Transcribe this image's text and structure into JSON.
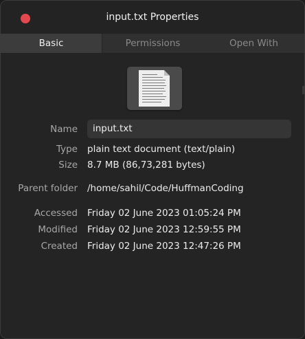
{
  "window": {
    "title": "input.txt Properties"
  },
  "tabs": [
    {
      "label": "Basic",
      "active": true
    },
    {
      "label": "Permissions",
      "active": false
    },
    {
      "label": "Open With",
      "active": false
    }
  ],
  "file": {
    "icon": "text-document-icon",
    "name_label": "Name",
    "name_value": "input.txt",
    "type_label": "Type",
    "type_value": "plain text document (text/plain)",
    "size_label": "Size",
    "size_value": "8.7 MB (86,73,281 bytes)",
    "parent_label": "Parent folder",
    "parent_value": "/home/sahil/Code/HuffmanCoding",
    "accessed_label": "Accessed",
    "accessed_value": "Friday 02 June 2023 01:05:24 PM",
    "modified_label": "Modified",
    "modified_value": "Friday 02 June 2023 12:59:55 PM",
    "created_label": "Created",
    "created_value": "Friday 02 June 2023 12:47:26 PM"
  },
  "colors": {
    "close_button": "#e2484e",
    "background": "#242424",
    "titlebar": "#232323"
  }
}
